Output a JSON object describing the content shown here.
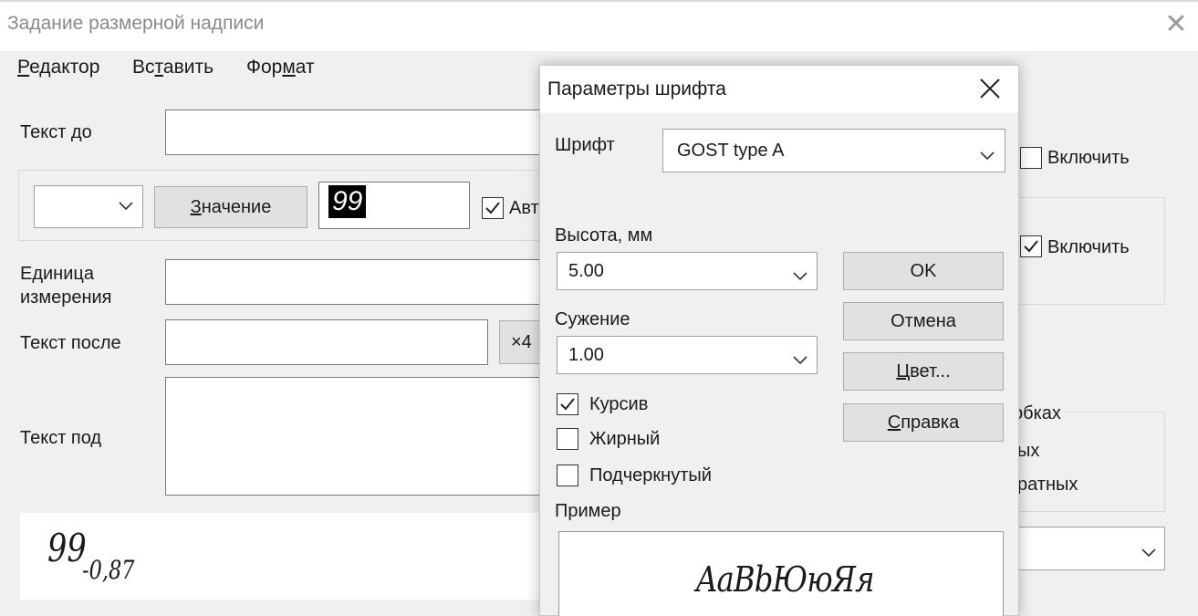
{
  "window": {
    "title": "Задание размерной надписи",
    "close_glyph": "✕"
  },
  "menu": {
    "items": [
      {
        "label": "Редактор",
        "mnemonic": "Р"
      },
      {
        "label": "Вставить",
        "mnemonic": "т"
      },
      {
        "label": "Формат",
        "mnemonic": "м"
      }
    ]
  },
  "form": {
    "text_before_label": "Текст до",
    "text_before_value": "",
    "value_button_label": "Значение",
    "value_field": "99",
    "auto_checkbox_label_visible": "Авт",
    "auto_checked": true,
    "unit_label_line1": "Единица",
    "unit_label_line2": "измерения",
    "unit_value": "",
    "text_after_label": "Текст после",
    "text_after_value": "",
    "multiplier_button_visible": "×4",
    "text_under_label": "Текст под",
    "text_under_value": "",
    "preview_main": "99",
    "preview_sub": "-0,87"
  },
  "right_panel": {
    "enable1_label": "Включить",
    "enable1_checked": false,
    "enable2_label": "Включить",
    "enable2_checked": true,
    "group_fragment1": "обках",
    "group_fragment2": "ых",
    "group_fragment3": "ратных",
    "dropdown_value": ""
  },
  "dialog": {
    "title": "Параметры шрифта",
    "font_label": "Шрифт",
    "font_value": "GOST type A",
    "height_label": "Высота, мм",
    "height_value": "5.00",
    "narrowing_label": "Сужение",
    "narrowing_value": "1.00",
    "italic_label": "Курсив",
    "italic_checked": true,
    "bold_label": "Жирный",
    "bold_checked": false,
    "underline_label": "Подчеркнутый",
    "underline_checked": false,
    "sample_label": "Пример",
    "sample_text": "AaBbЮюЯя",
    "ok_label": "OK",
    "cancel_label": "Отмена",
    "color_label": "Цвет...",
    "help_label": "Справка"
  }
}
